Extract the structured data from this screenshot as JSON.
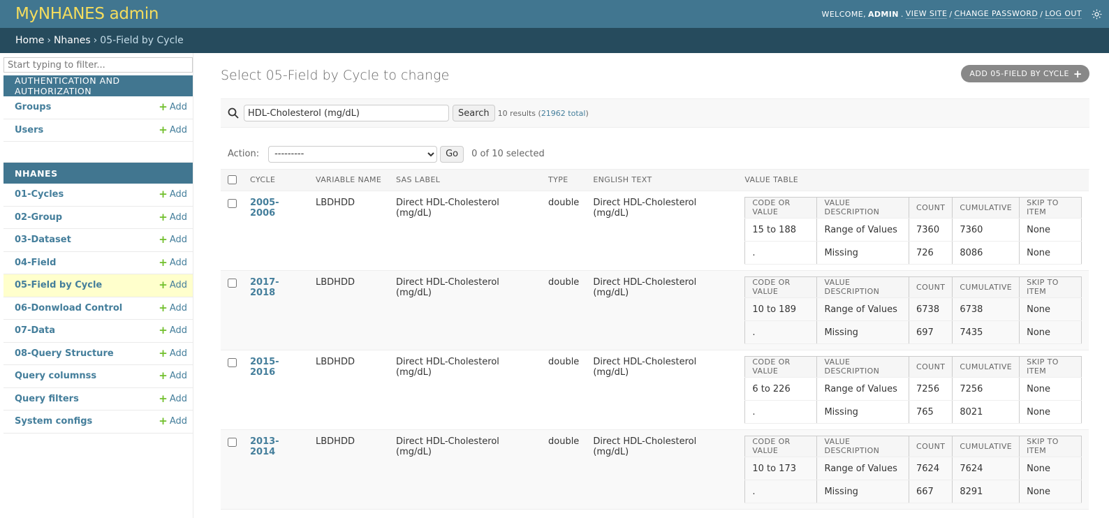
{
  "header": {
    "brand": "MyNHANES admin",
    "welcome": "WELCOME,",
    "user": "ADMIN",
    "view_site": "VIEW SITE",
    "change_password": "CHANGE PASSWORD",
    "log_out": "LOG OUT",
    "sep": "/"
  },
  "breadcrumbs": {
    "home": "Home",
    "app": "Nhanes",
    "current": "05-Field by Cycle",
    "sep": "›"
  },
  "sidebar": {
    "filter_placeholder": "Start typing to filter...",
    "add_label": "Add",
    "modules": [
      {
        "caption": "Authentication and Authorization",
        "items": [
          {
            "label": "Groups"
          },
          {
            "label": "Users"
          }
        ]
      },
      {
        "caption": "NHANES",
        "items": [
          {
            "label": "01-Cycles"
          },
          {
            "label": "02-Group"
          },
          {
            "label": "03-Dataset"
          },
          {
            "label": "04-Field"
          },
          {
            "label": "05-Field by Cycle",
            "current": true
          },
          {
            "label": "06-Donwload Control"
          },
          {
            "label": "07-Data"
          },
          {
            "label": "08-Query Structure"
          },
          {
            "label": "Query columnss"
          },
          {
            "label": "Query filters"
          },
          {
            "label": "System configs"
          }
        ]
      }
    ]
  },
  "content": {
    "title": "Select 05-Field by Cycle to change",
    "add_button": "ADD 05-FIELD BY CYCLE",
    "search": {
      "value": "HDL-Cholesterol (mg/dL)",
      "button": "Search",
      "results_prefix": "10 results (",
      "total_link": "21962 total",
      "results_suffix": ")"
    },
    "actions": {
      "label": "Action:",
      "selected_option": "---------",
      "go": "Go",
      "counter": "0 of 10 selected"
    },
    "columns": [
      "Cycle",
      "Variable name",
      "SAS label",
      "Type",
      "English text",
      "Value table"
    ],
    "vt_headers": [
      "Code or Value",
      "Value Description",
      "Count",
      "Cumulative",
      "Skip to Item"
    ],
    "rows": [
      {
        "cycle": "2005-2006",
        "variable": "LBDHDD",
        "sas_label": "Direct HDL-Cholesterol (mg/dL)",
        "type": "double",
        "english": "Direct HDL-Cholesterol (mg/dL)",
        "vt": [
          [
            "15 to 188",
            "Range of Values",
            "7360",
            "7360",
            "None"
          ],
          [
            ".",
            "Missing",
            "726",
            "8086",
            "None"
          ]
        ]
      },
      {
        "cycle": "2017-2018",
        "variable": "LBDHDD",
        "sas_label": "Direct HDL-Cholesterol (mg/dL)",
        "type": "double",
        "english": "Direct HDL-Cholesterol (mg/dL)",
        "vt": [
          [
            "10 to 189",
            "Range of Values",
            "6738",
            "6738",
            "None"
          ],
          [
            ".",
            "Missing",
            "697",
            "7435",
            "None"
          ]
        ]
      },
      {
        "cycle": "2015-2016",
        "variable": "LBDHDD",
        "sas_label": "Direct HDL-Cholesterol (mg/dL)",
        "type": "double",
        "english": "Direct HDL-Cholesterol (mg/dL)",
        "vt": [
          [
            "6 to 226",
            "Range of Values",
            "7256",
            "7256",
            "None"
          ],
          [
            ".",
            "Missing",
            "765",
            "8021",
            "None"
          ]
        ]
      },
      {
        "cycle": "2013-2014",
        "variable": "LBDHDD",
        "sas_label": "Direct HDL-Cholesterol (mg/dL)",
        "type": "double",
        "english": "Direct HDL-Cholesterol (mg/dL)",
        "vt": [
          [
            "10 to 173",
            "Range of Values",
            "7624",
            "7624",
            "None"
          ],
          [
            ".",
            "Missing",
            "667",
            "8291",
            "None"
          ]
        ]
      }
    ]
  },
  "icons": {
    "search": "search-icon",
    "theme": "sun-icon",
    "add": "plus-icon"
  },
  "colors": {
    "header_bg": "#417690",
    "brand": "#f5dd5d",
    "breadcrumbs_bg": "#264b5d",
    "link": "#447e9b",
    "add_plus": "#70bf2b",
    "current_row": "#ffffcc"
  }
}
